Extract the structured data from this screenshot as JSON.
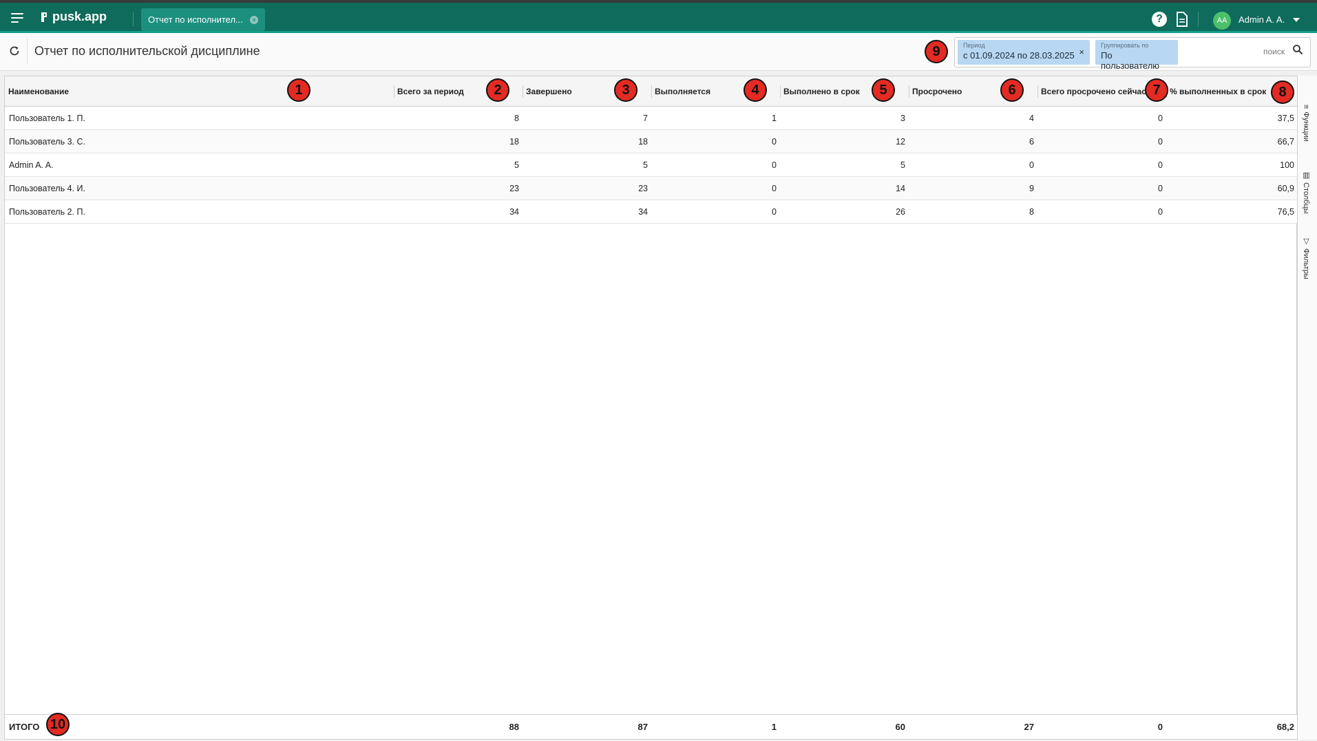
{
  "app": {
    "logo_text": "pusk.app",
    "tab_label": "Отчет по исполнител...",
    "user_initials": "AA",
    "user_name": "Admin A. A."
  },
  "header": {
    "title": "Отчет по исполнительской дисциплине",
    "filters": [
      {
        "label": "Период",
        "value": "с 01.09.2024 по 28.03.2025",
        "removable": true
      },
      {
        "label": "Группировать по",
        "value": "По пользователю",
        "removable": false
      }
    ],
    "search_placeholder": "поиск"
  },
  "table": {
    "columns": [
      "Наименование",
      "Всего за период",
      "Завершено",
      "Выполняется",
      "Выполнено в срок",
      "Просрочено",
      "Всего просрочено сейчас",
      "% выполненных в срок"
    ],
    "rows": [
      [
        "Пользователь 1. П.",
        "8",
        "7",
        "1",
        "3",
        "4",
        "0",
        "37,5"
      ],
      [
        "Пользователь 3. С.",
        "18",
        "18",
        "0",
        "12",
        "6",
        "0",
        "66,7"
      ],
      [
        "Admin A. A.",
        "5",
        "5",
        "0",
        "5",
        "0",
        "0",
        "100"
      ],
      [
        "Пользователь 4. И.",
        "23",
        "23",
        "0",
        "14",
        "9",
        "0",
        "60,9"
      ],
      [
        "Пользователь 2. П.",
        "34",
        "34",
        "0",
        "26",
        "8",
        "0",
        "76,5"
      ]
    ],
    "totals": [
      "ИТОГО",
      "88",
      "87",
      "1",
      "60",
      "27",
      "0",
      "68,2"
    ]
  },
  "side_panel": {
    "tabs": [
      "Функции",
      "Столбцы",
      "Фильтры"
    ]
  },
  "annotations": [
    "1",
    "2",
    "3",
    "4",
    "5",
    "6",
    "7",
    "8",
    "9",
    "10"
  ],
  "colors": {
    "topbar": "#0f6b5c",
    "tab_active": "#1d8f7f",
    "chip": "#b8d7f2",
    "badge": "#e32b23"
  }
}
